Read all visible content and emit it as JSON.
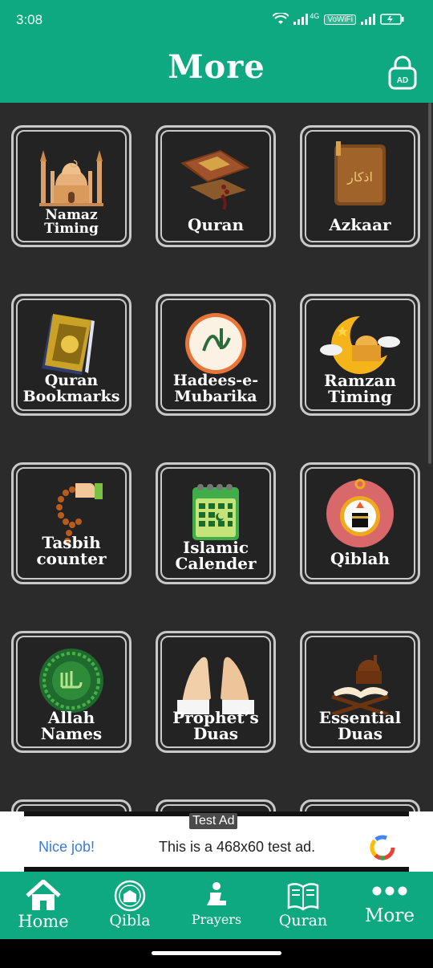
{
  "status": {
    "time": "3:08",
    "network": "4G",
    "vowifi": "VoWiFi"
  },
  "header": {
    "title": "More",
    "lock_text": "AD"
  },
  "tiles": [
    {
      "label": "Namaz\nTiming",
      "icon": "mosque-icon"
    },
    {
      "label": "Quran",
      "icon": "quran-icon"
    },
    {
      "label": "Azkaar",
      "icon": "azkaar-book-icon"
    },
    {
      "label": "Quran\nBookmarks",
      "icon": "quran-book-icon"
    },
    {
      "label": "Hadees-e-\nMubarika",
      "icon": "calligraphy-icon"
    },
    {
      "label": "Ramzan\nTiming",
      "icon": "crescent-mosque-icon"
    },
    {
      "label": "Tasbih\ncounter",
      "icon": "tasbih-icon"
    },
    {
      "label": "Islamic\nCalender",
      "icon": "calendar-icon"
    },
    {
      "label": "Qiblah",
      "icon": "compass-kaaba-icon"
    },
    {
      "label": "Allah\nNames",
      "icon": "allah-calligraphy-icon"
    },
    {
      "label": "Prophet’s\nDuas",
      "icon": "praying-hands-icon"
    },
    {
      "label": "Essential\nDuas",
      "icon": "quran-stand-icon"
    }
  ],
  "ad": {
    "tag": "Test Ad",
    "headline": "Nice job!",
    "body": "This is a 468x60 test ad."
  },
  "nav": [
    {
      "label": "Home",
      "icon": "home-icon"
    },
    {
      "label": "Qibla",
      "icon": "kaaba-icon"
    },
    {
      "label": "Prayers",
      "icon": "prayer-person-icon"
    },
    {
      "label": "Quran",
      "icon": "open-book-icon"
    },
    {
      "label": "More",
      "icon": "more-dots-icon"
    }
  ],
  "colors": {
    "primary": "#0ea980",
    "background": "#2b2b2b",
    "tile_border": "#c9c9c9"
  }
}
